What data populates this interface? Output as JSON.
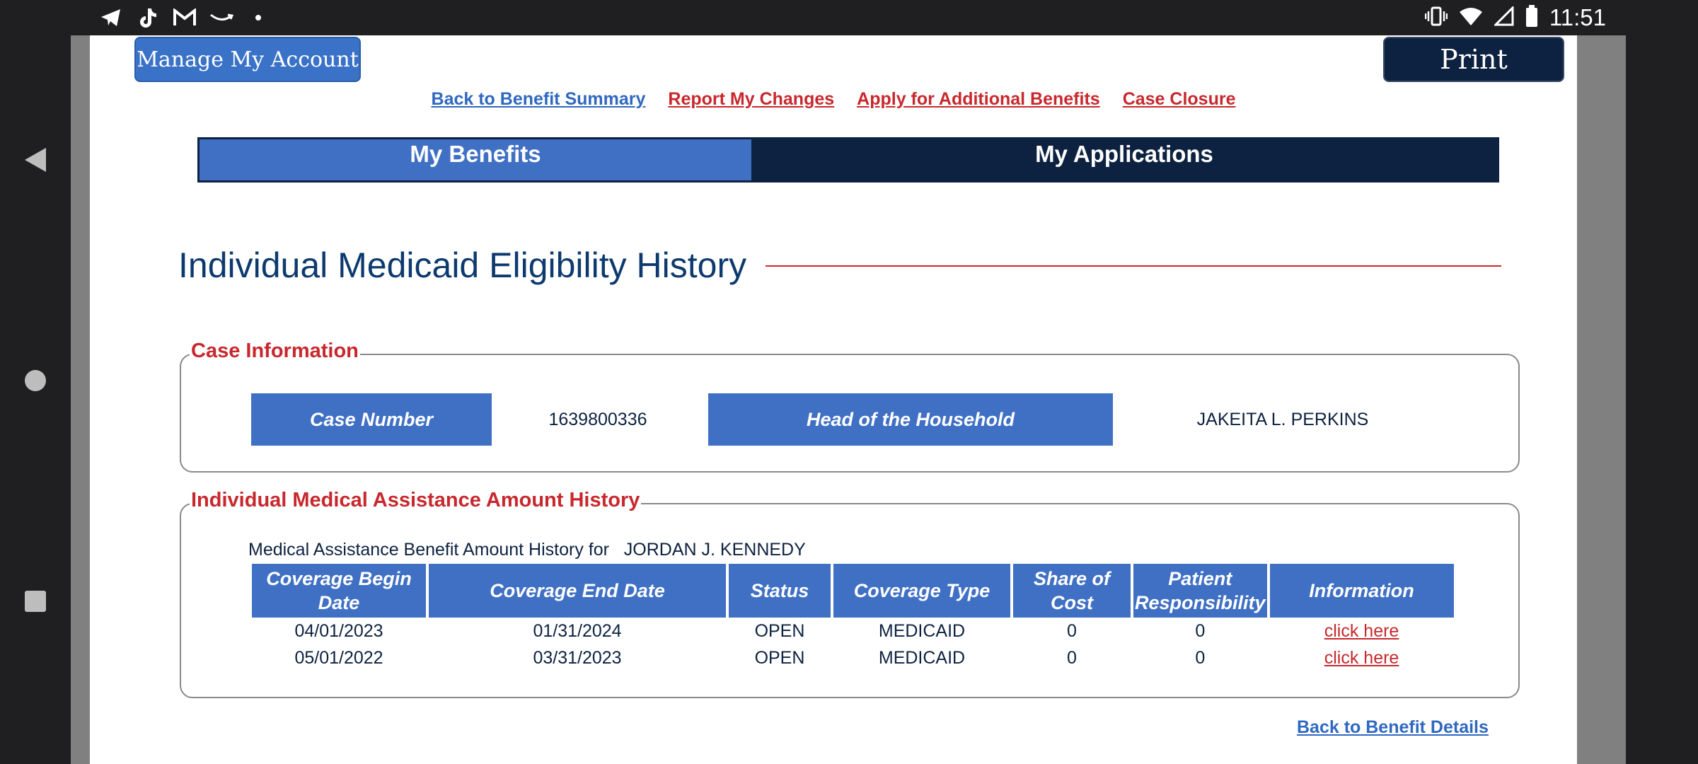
{
  "status_bar": {
    "time": "11:51",
    "left_icons": [
      "telegram-icon",
      "tiktok-icon",
      "gmail-icon",
      "amazon-icon",
      "dot-icon"
    ],
    "right_icons": [
      "vibrate-icon",
      "wifi-icon",
      "signal-icon",
      "battery-icon"
    ]
  },
  "header": {
    "manage_label": "Manage My Account",
    "print_label": "Print"
  },
  "links": [
    {
      "label": "Back to Benefit Summary",
      "color": "#2f68c0"
    },
    {
      "label": "Report My Changes",
      "color": "#c8282d"
    },
    {
      "label": "Apply for Additional Benefits",
      "color": "#c8282d"
    },
    {
      "label": "Case Closure",
      "color": "#c8282d"
    }
  ],
  "tabs": {
    "benefits": "My Benefits",
    "applications": "My Applications"
  },
  "page_title": "Individual Medicaid Eligibility History",
  "case_info": {
    "legend": "Case Information",
    "case_number_label": "Case Number",
    "case_number": "1639800336",
    "hoh_label": "Head of the Household",
    "hoh_name": "JAKEITA L. PERKINS"
  },
  "history": {
    "legend": "Individual Medical Assistance Amount History",
    "caption_prefix": "Medical Assistance Benefit Amount History for",
    "person": "JORDAN J. KENNEDY",
    "columns": [
      "Coverage Begin Date",
      "Coverage End Date",
      "Status",
      "Coverage Type",
      "Share of Cost",
      "Patient Responsibility",
      "Information"
    ],
    "rows": [
      {
        "begin": "04/01/2023",
        "end": "01/31/2024",
        "status": "OPEN",
        "type": "MEDICAID",
        "share": "0",
        "patient": "0",
        "info": "click here"
      },
      {
        "begin": "05/01/2022",
        "end": "03/31/2023",
        "status": "OPEN",
        "type": "MEDICAID",
        "share": "0",
        "patient": "0",
        "info": "click here"
      }
    ]
  },
  "footer": {
    "back_details": "Back to Benefit Details"
  },
  "colors": {
    "primary_blue": "#4070c4",
    "navy": "#0d2240",
    "accent_red": "#c8282d"
  }
}
